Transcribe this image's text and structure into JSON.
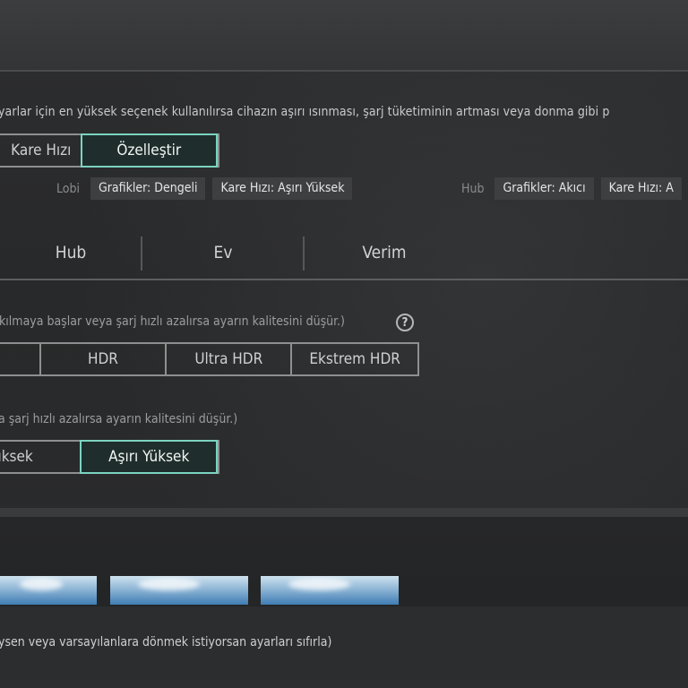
{
  "warning_text": "yarlar için en yüksek seçenek kullanılırsa cihazın aşırı ısınması, şarj tüketiminin artması veya donma gibi p",
  "mode_selector": {
    "options": [
      "Kare Hızı",
      "Özelleştir"
    ],
    "selected": "Özelleştir"
  },
  "presets": {
    "lobi": {
      "label": "Lobi",
      "graphics": "Grafikler: Dengeli",
      "framerate": "Kare Hızı: Aşırı Yüksek"
    },
    "hub": {
      "label": "Hub",
      "graphics": "Grafikler: Akıcı",
      "framerate": "Kare Hızı: A"
    }
  },
  "tabs": [
    "Hub",
    "Ev",
    "Verim"
  ],
  "graphics": {
    "note": "kılmaya başlar veya şarj hızlı azalırsa ayarın kalitesini düşür.)",
    "help_glyph": "?",
    "options": [
      "",
      "HDR",
      "Ultra HDR",
      "Ekstrem HDR"
    ]
  },
  "framerate": {
    "note": "a şarj hızlı azalırsa ayarın kalitesini düşür.)",
    "options": [
      "üksek",
      "Aşırı Yüksek"
    ],
    "selected": "Aşırı Yüksek"
  },
  "footer_text": "ysen veya varsayılanlara dönmek istiyorsan ayarları sıfırla)",
  "colors": {
    "accent": "#7bd3c0",
    "selected_bg": "#1f2e2c",
    "border": "#8d8f91"
  }
}
